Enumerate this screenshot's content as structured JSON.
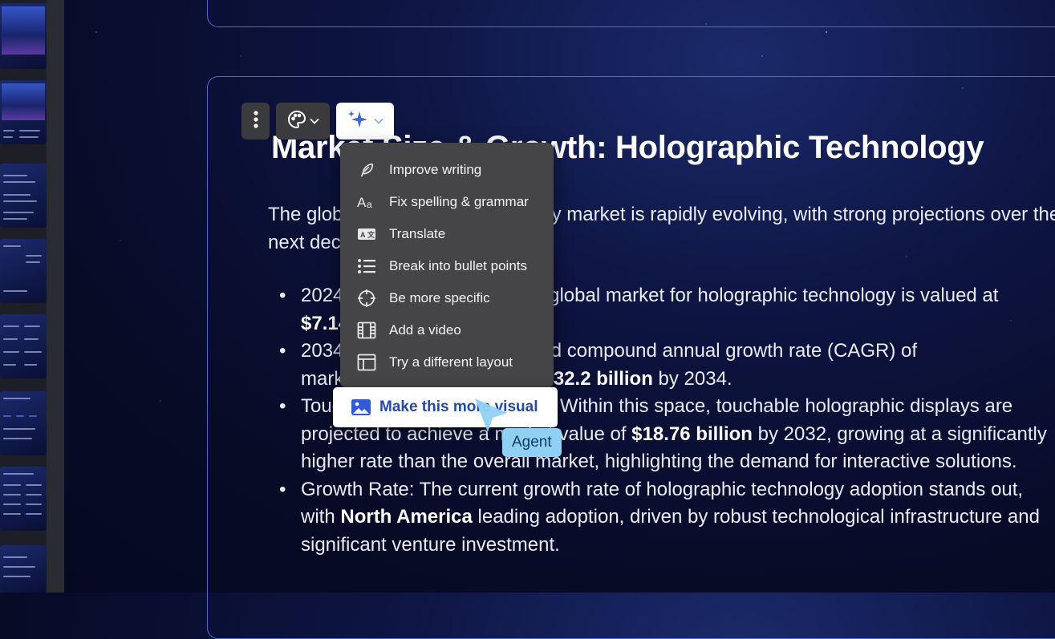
{
  "slide": {
    "title": "Market Size & Growth: Holographic Technology",
    "intro": "The global holographic technology market is rapidly evolving, with strong projections over the next decade.",
    "bullets": [
      {
        "lines": [
          [
            "2024 Baseline: The baseline global market for holographic technology is valued at "
          ],
          [
            {
              "b": "$7.14"
            },
            " billion."
          ]
        ]
      },
      {
        "lines": [
          [
            "2034 Projection: The expected compound annual growth rate (CAGR) of "
          ],
          [
            "market is expected to reach ",
            {
              "b": "$32.2 billion"
            },
            " by 2034."
          ]
        ]
      },
      {
        "lines": [
          [
            "Touchable Displays Segment: Within this space, touchable holographic displays are"
          ],
          [
            "projected to achieve a market value of ",
            {
              "b": "$18.76 billion"
            },
            " by 2032, growing at a significantly"
          ],
          [
            "higher rate than the overall market, highlighting the demand for interactive solutions."
          ]
        ]
      },
      {
        "lines": [
          [
            "Growth Rate: The current growth rate of holographic technology adoption stands out,"
          ],
          [
            "with ",
            {
              "b": "North America"
            },
            " leading adoption, driven by robust technological infrastructure and"
          ],
          [
            "significant venture investment."
          ]
        ]
      }
    ]
  },
  "toolbar": {
    "more_icon": "vertical-dots-icon",
    "theme_icon": "palette-icon",
    "ai_icon": "sparkles-icon"
  },
  "ai_menu": {
    "items": [
      {
        "label": "Improve writing",
        "icon": "feather-icon"
      },
      {
        "label": "Fix spelling & grammar",
        "icon": "spellcheck-icon"
      },
      {
        "label": "Translate",
        "icon": "translate-icon"
      },
      {
        "label": "Break into bullet points",
        "icon": "bullet-list-icon"
      },
      {
        "label": "Be more specific",
        "icon": "crosshair-icon"
      },
      {
        "label": "Add a video",
        "icon": "film-icon"
      },
      {
        "label": "Try a different layout",
        "icon": "layout-icon"
      }
    ],
    "highlighted": {
      "label": "Make this more visual",
      "icon": "image-icon"
    }
  },
  "agent_tag": "Agent"
}
